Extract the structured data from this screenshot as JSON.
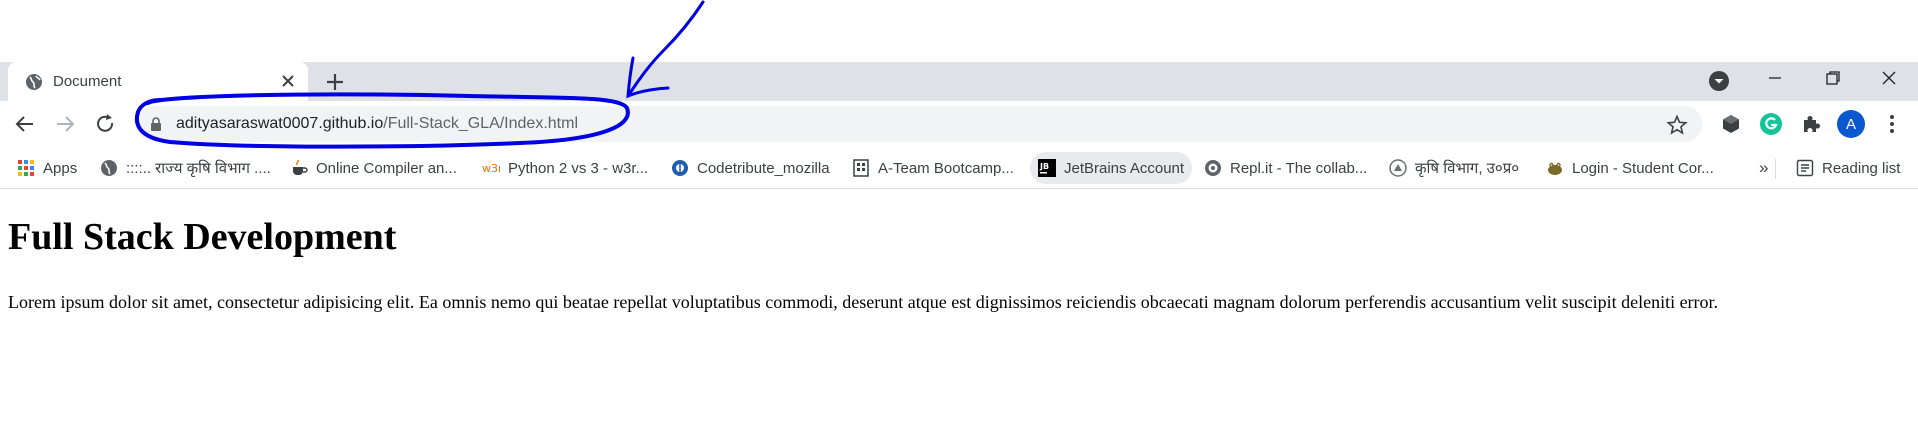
{
  "browser": {
    "tab": {
      "title": "Document"
    },
    "address": {
      "host": "adityasaraswat0007.github.io",
      "path": "/Full-Stack_GLA/Index.html"
    },
    "avatar_letter": "A",
    "colors": {
      "tabstrip": "#dee1e6",
      "omnibox": "#f1f3f4",
      "accent": "#0b57d0",
      "annotation": "#0000e0"
    }
  },
  "bookmarks": {
    "items": [
      {
        "label": "Apps",
        "icon": "apps-grid-icon"
      },
      {
        "label": "::::.. राज्य कृषि विभाग ....",
        "icon": "globe-icon"
      },
      {
        "label": "Online Compiler an...",
        "icon": "coffee-cup-icon"
      },
      {
        "label": "Python 2 vs 3 - w3r...",
        "icon": "w3r-icon"
      },
      {
        "label": "Codetribute_mozilla",
        "icon": "codetribute-icon"
      },
      {
        "label": "A-Team Bootcamp...",
        "icon": "building-icon"
      },
      {
        "label": "JetBrains Account",
        "icon": "jetbrains-icon"
      },
      {
        "label": "Repl.it - The collab...",
        "icon": "replit-icon"
      },
      {
        "label": "कृषि विभाग, उ०प्र०",
        "icon": "emblem-icon"
      },
      {
        "label": "Login - Student Cor...",
        "icon": "frog-icon"
      }
    ],
    "overflow": "»",
    "reading_list": "Reading list"
  },
  "page": {
    "heading": "Full Stack Development",
    "paragraph": "Lorem ipsum dolor sit amet, consectetur adipisicing elit. Ea omnis nemo qui beatae repellat voluptatibus commodi, deserunt atque est dignissimos reiciendis obcaecati magnam dolorum perferendis accusantium velit suscipit deleniti error."
  }
}
